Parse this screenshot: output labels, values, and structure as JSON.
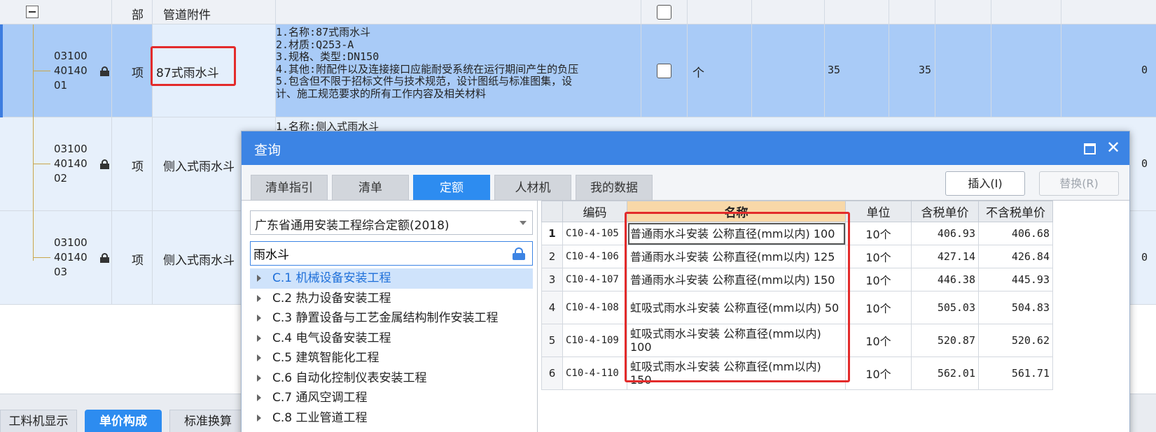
{
  "header": {
    "type_label": "部",
    "name_label": "管道附件"
  },
  "rows": [
    {
      "code_lines": [
        "03100",
        "40140",
        "01"
      ],
      "type": "项",
      "name": "87式雨水斗",
      "desc_lines": [
        "1.名称:87式雨水斗",
        "2.材质:Q253-A",
        "3.规格、类型:DN150",
        "4.其他:附配件以及连接接口应能耐受系统在运行期间产生的负压",
        "5.包含但不限于招标文件与技术规范，设计图纸与标准图集，设",
        "计、施工规范要求的所有工作内容及相关材料"
      ],
      "unit": "个",
      "qty1": "35",
      "qty2": "35",
      "total": "0"
    },
    {
      "code_lines": [
        "03100",
        "40140",
        "02"
      ],
      "type": "项",
      "name": "侧入式雨水斗",
      "desc_lines": [
        "1.名称:侧入式雨水斗"
      ],
      "total": "0"
    },
    {
      "code_lines": [
        "03100",
        "40140",
        "03"
      ],
      "type": "项",
      "name": "侧入式雨水斗",
      "total": "0"
    }
  ],
  "bottom_tabs": [
    "工料机显示",
    "单价构成",
    "标准换算"
  ],
  "dialog": {
    "title": "查询",
    "tabs": [
      "清单指引",
      "清单",
      "定额",
      "人材机",
      "我的数据"
    ],
    "active_tab": "定额",
    "insert_button": "插入(I)",
    "replace_button": "替换(R)",
    "quota_db": "广东省通用安装工程综合定额(2018)",
    "search_value": "雨水斗",
    "tree": [
      "C.1 机械设备安装工程",
      "C.2 热力设备安装工程",
      "C.3 静置设备与工艺金属结构制作安装工程",
      "C.4 电气设备安装工程",
      "C.5 建筑智能化工程",
      "C.6 自动化控制仪表安装工程",
      "C.7 通风空调工程",
      "C.8 工业管道工程"
    ],
    "table": {
      "columns": [
        "",
        "编码",
        "名称",
        "单位",
        "含税单价",
        "不含税单价"
      ],
      "rows": [
        {
          "n": "1",
          "code": "C10-4-105",
          "name": "普通雨水斗安装 公称直径(mm以内) 100",
          "unit": "10个",
          "price_tax": "406.93",
          "price_notax": "406.68"
        },
        {
          "n": "2",
          "code": "C10-4-106",
          "name": "普通雨水斗安装 公称直径(mm以内) 125",
          "unit": "10个",
          "price_tax": "427.14",
          "price_notax": "426.84"
        },
        {
          "n": "3",
          "code": "C10-4-107",
          "name": "普通雨水斗安装 公称直径(mm以内) 150",
          "unit": "10个",
          "price_tax": "446.38",
          "price_notax": "445.93"
        },
        {
          "n": "4",
          "code": "C10-4-108",
          "name": "虹吸式雨水斗安装 公称直径(mm以内) 50",
          "unit": "10个",
          "price_tax": "505.03",
          "price_notax": "504.83"
        },
        {
          "n": "5",
          "code": "C10-4-109",
          "name": "虹吸式雨水斗安装 公称直径(mm以内) 100",
          "unit": "10个",
          "price_tax": "520.87",
          "price_notax": "520.62"
        },
        {
          "n": "6",
          "code": "C10-4-110",
          "name": "虹吸式雨水斗安装 公称直径(mm以内) 150",
          "unit": "10个",
          "price_tax": "562.01",
          "price_notax": "561.71"
        }
      ]
    }
  },
  "colors": {
    "selected_row": "#a9cbf7",
    "other_rows": "#e7f0fb",
    "dialog_title": "#3c84e4",
    "active_tab": "#2d8cf0",
    "highlight_box": "#e32b2b",
    "name_header": "#f8d8a8"
  }
}
